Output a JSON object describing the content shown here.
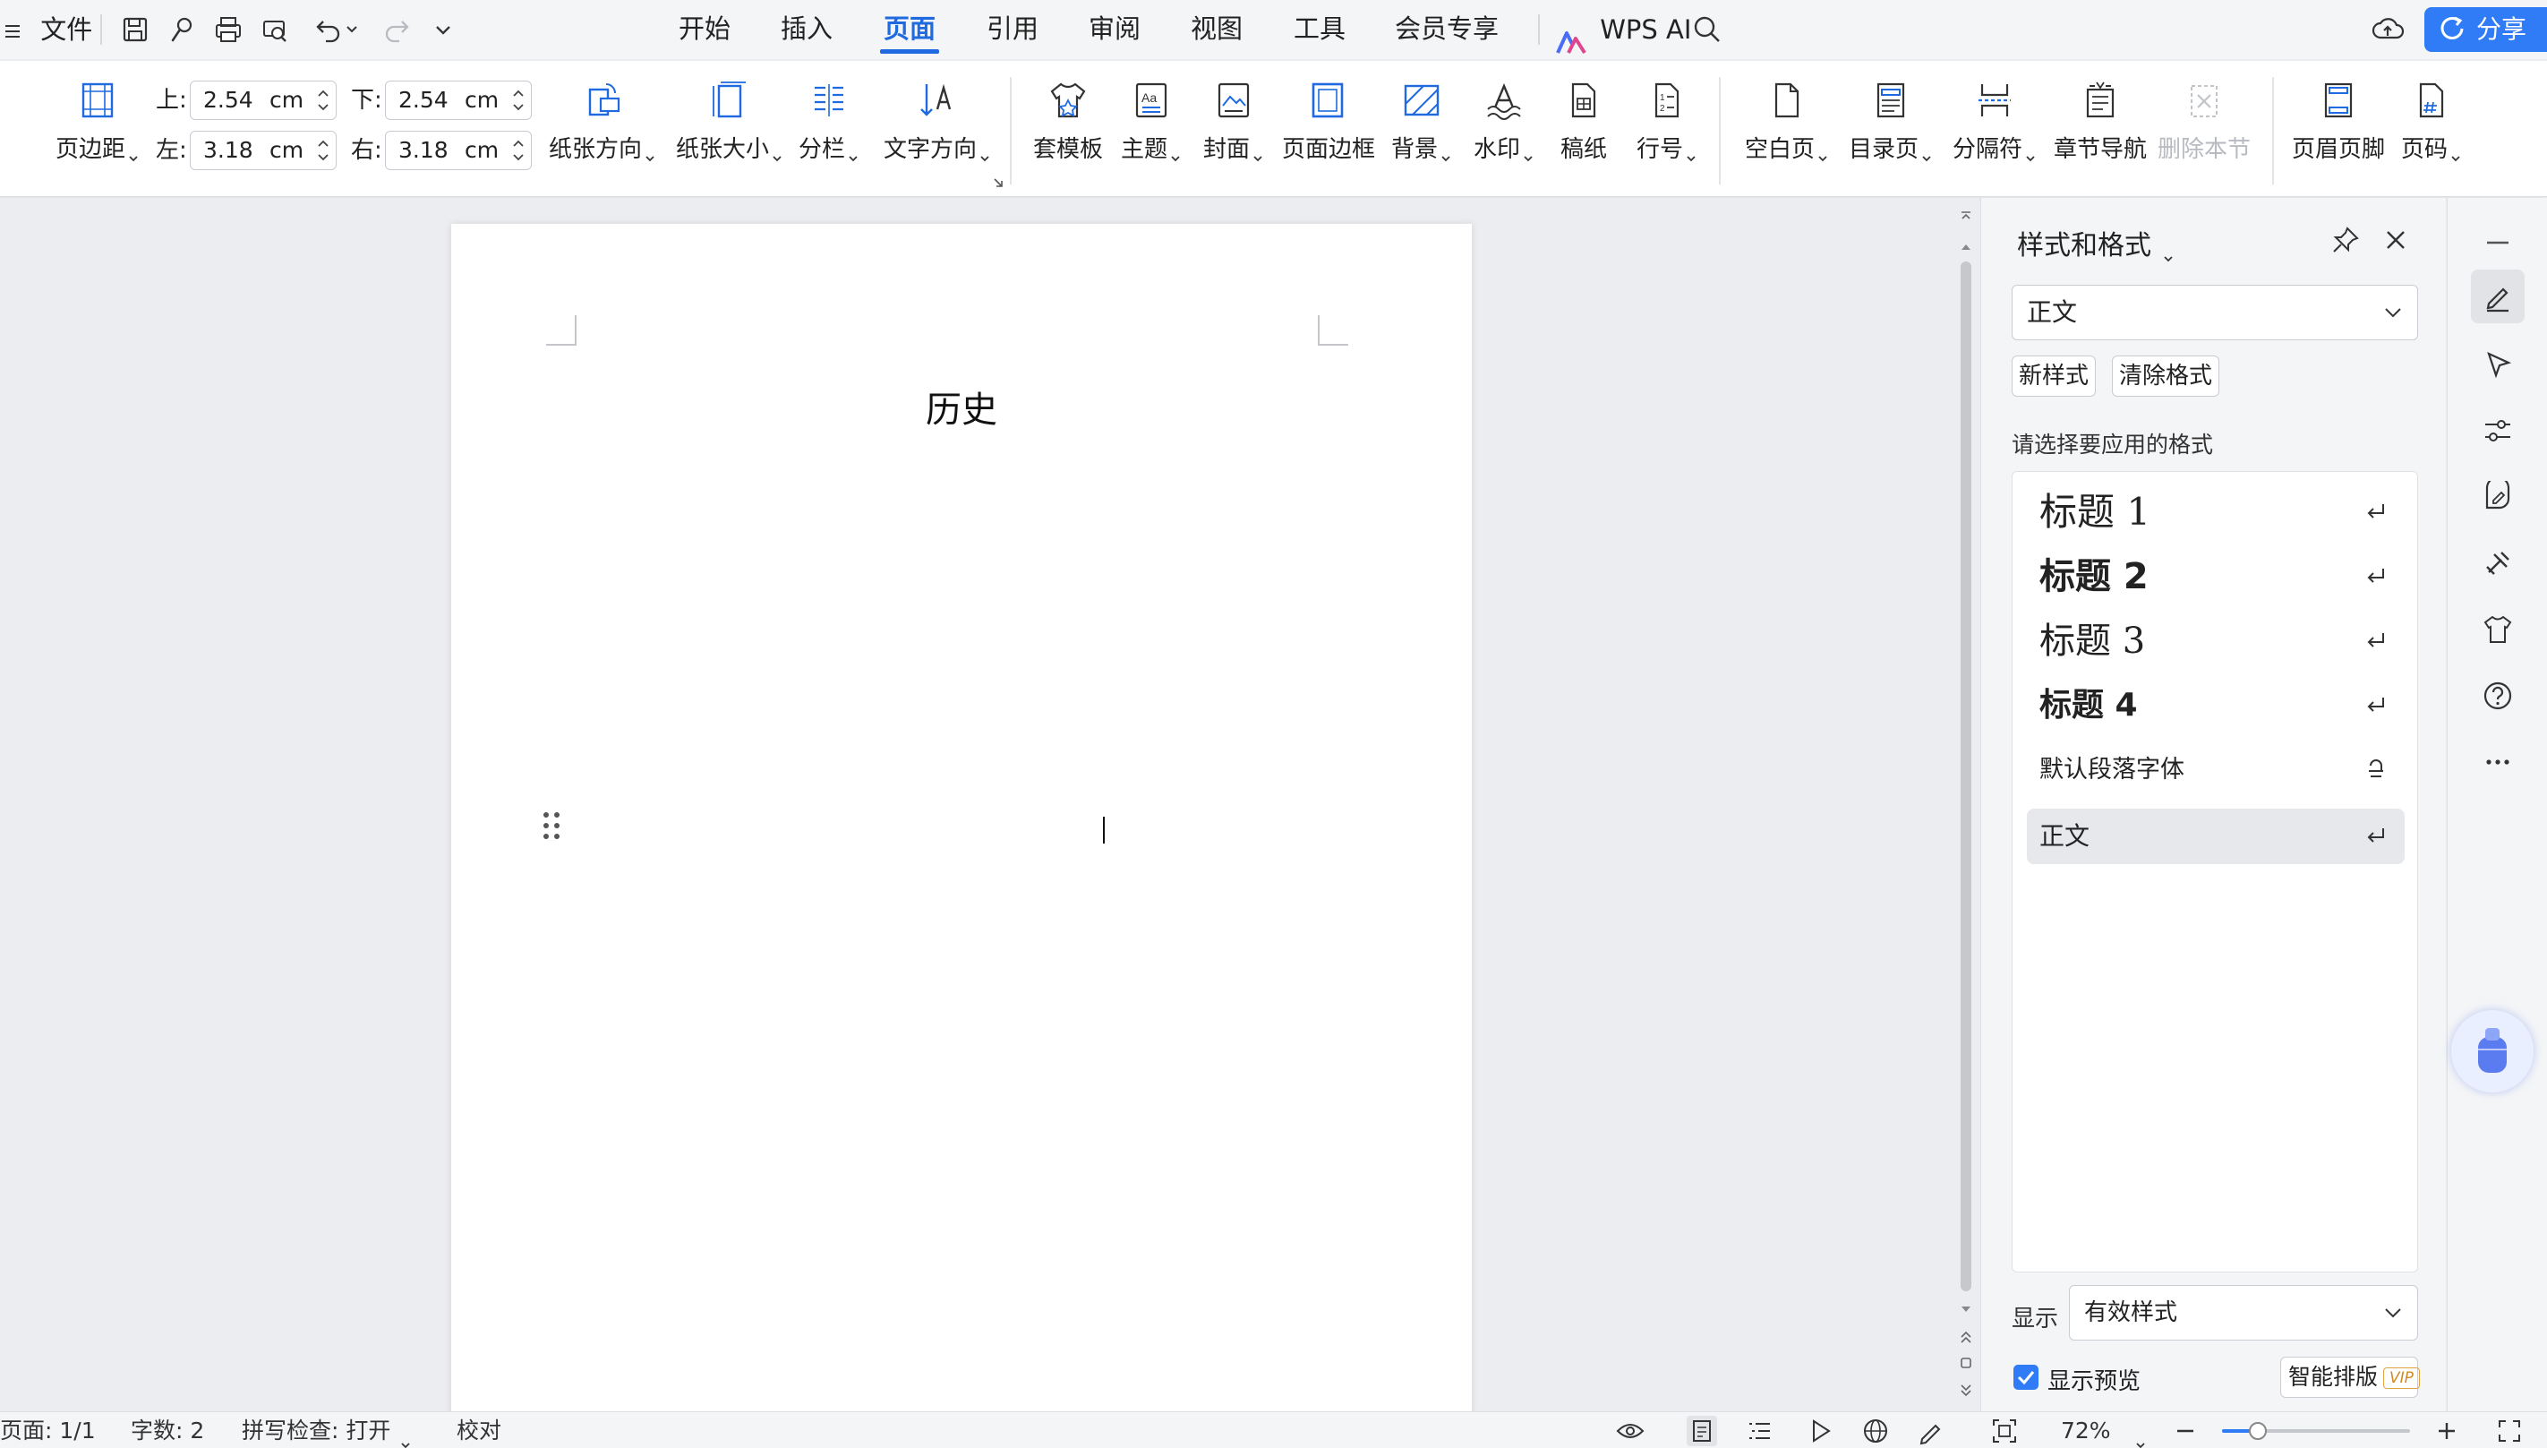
{
  "menu": {
    "file_label": "文件",
    "tabs": [
      {
        "label": "开始"
      },
      {
        "label": "插入"
      },
      {
        "label": "页面"
      },
      {
        "label": "引用"
      },
      {
        "label": "审阅"
      },
      {
        "label": "视图"
      },
      {
        "label": "工具"
      },
      {
        "label": "会员专享"
      }
    ],
    "active_tab": "页面",
    "wps_ai_label": "WPS AI",
    "share_label": "分享"
  },
  "ribbon": {
    "margins_label": "页边距",
    "margin_top_label": "上:",
    "margin_top_value": "2.54",
    "margin_bottom_label": "下:",
    "margin_bottom_value": "2.54",
    "margin_left_label": "左:",
    "margin_left_value": "3.18",
    "margin_right_label": "右:",
    "margin_right_value": "3.18",
    "unit": "cm",
    "orientation_label": "纸张方向",
    "paper_size_label": "纸张大小",
    "columns_label": "分栏",
    "text_direction_label": "文字方向",
    "template_label": "套模板",
    "theme_label": "主题",
    "cover_label": "封面",
    "page_border_label": "页面边框",
    "background_label": "背景",
    "watermark_label": "水印",
    "manuscript_label": "稿纸",
    "line_number_label": "行号",
    "blank_page_label": "空白页",
    "toc_page_label": "目录页",
    "separator_label": "分隔符",
    "chapter_nav_label": "章节导航",
    "delete_section_label": "删除本节",
    "header_footer_label": "页眉页脚",
    "page_number_label": "页码"
  },
  "document": {
    "title": "历史"
  },
  "style_pane": {
    "title": "样式和格式",
    "current_style": "正文",
    "new_style_label": "新样式",
    "clear_format_label": "清除格式",
    "hint": "请选择要应用的格式",
    "styles": [
      {
        "name": "标题 1"
      },
      {
        "name": "标题 2"
      },
      {
        "name": "标题 3"
      },
      {
        "name": "标题 4"
      },
      {
        "name": "默认段落字体"
      },
      {
        "name": "正文"
      }
    ],
    "selected_style": "正文",
    "show_label": "显示",
    "show_value": "有效样式",
    "preview_label": "显示预览",
    "preview_checked": true,
    "smart_layout_label": "智能排版",
    "vip_badge": "VIP"
  },
  "status": {
    "page": "页面: 1/1",
    "word_count": "字数: 2",
    "spell_check": "拼写检查: 打开",
    "proofread": "校对",
    "zoom": "72%",
    "zoom_level_fraction": 0.19
  },
  "colors": {
    "accent": "#2f7cf6",
    "active_tab": "#1f6ae0"
  }
}
